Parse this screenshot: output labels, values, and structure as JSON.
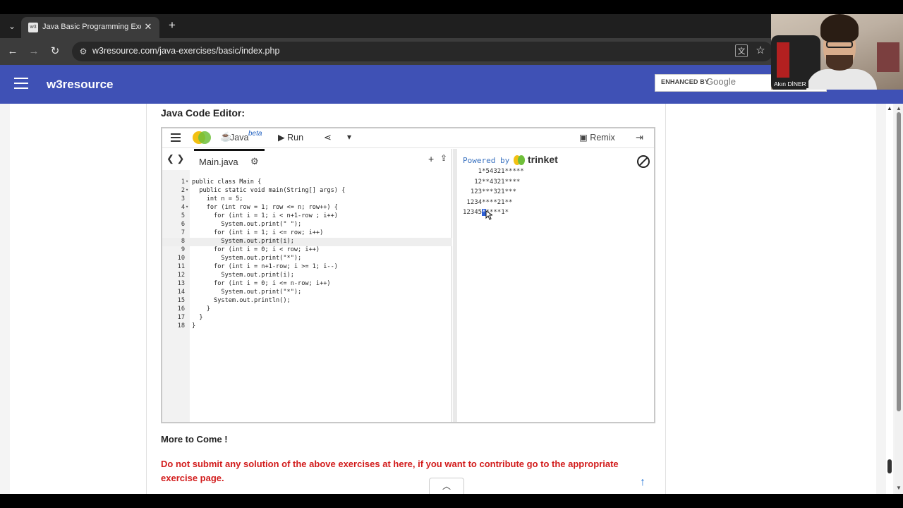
{
  "browser": {
    "tab_title": "Java Basic Programming Exercis",
    "tab_favicon": "w3",
    "url": "w3resource.com/java-exercises/basic/index.php",
    "tab_list_icon": "chevron-down-icon",
    "new_tab_icon": "plus-icon"
  },
  "header": {
    "brand": "w3resource",
    "search_placeholder": "ENHANCED BY",
    "search_logo": "Google",
    "brand_color": "#3f51b5"
  },
  "main": {
    "editor_heading": "Java Code Editor:",
    "more": "More to Come !",
    "warning": "Do not submit any solution of the above exercises at here, if you want to contribute go to the appropriate exercise page.",
    "warning_color": "#d21c1c"
  },
  "trinket": {
    "language": "Java",
    "beta": "beta",
    "run_label": "Run",
    "remix_label": "Remix",
    "filename": "Main.java",
    "powered_by": "Powered by",
    "brand": "trinket",
    "code_lines": [
      "public class Main {",
      "  public static void main(String[] args) {",
      "    int n = 5;",
      "    for (int row = 1; row <= n; row++) {",
      "      for (int i = 1; i < n+1-row ; i++)",
      "        System.out.print(\" \");",
      "      for (int i = 1; i <= row; i++)",
      "        System.out.print(i);",
      "      for (int i = 0; i < row; i++)",
      "        System.out.print(\"*\");",
      "      for (int i = n+1-row; i >= 1; i--)",
      "        System.out.print(i);",
      "      for (int i = 0; i <= n-row; i++)",
      "        System.out.print(\"*\");",
      "      System.out.println();",
      "    }",
      "  }",
      "}"
    ],
    "output_lines": [
      "    1*54321*****",
      "   12**4321****",
      "  123***321***",
      " 1234****21**",
      "12345*****1*"
    ],
    "output_last_prefix": "12345",
    "output_last_highlight": "*",
    "output_last_suffix": "****1*"
  },
  "webcam": {
    "name": "Akın DİNER"
  }
}
